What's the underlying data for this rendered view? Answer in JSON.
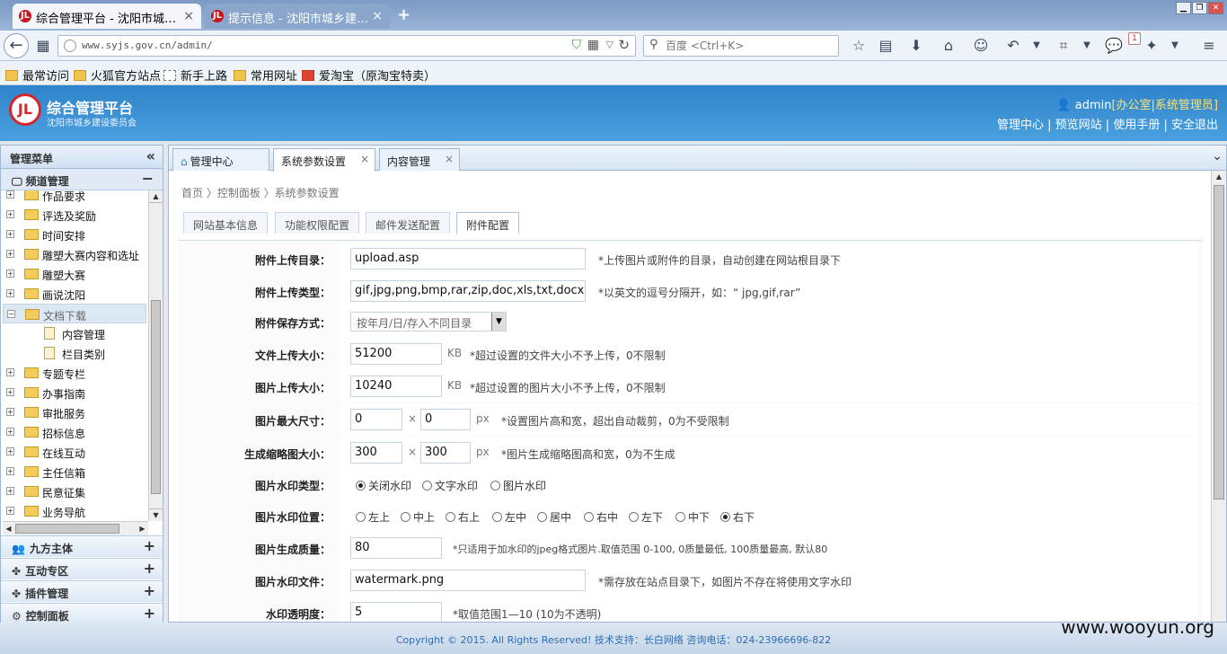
{
  "browser": {
    "tabs": [
      {
        "title": "综合管理平台 - 沈阳市城…",
        "active": true
      },
      {
        "title": "提示信息 - 沈阳市城乡建…",
        "active": false
      }
    ],
    "url": "www.syjs.gov.cn/admin/",
    "search_placeholder": "百度 <Ctrl+K>",
    "badge": "1",
    "bookmarks": [
      "最常访问",
      "火狐官方站点",
      "新手上路",
      "常用网址",
      "爱淘宝（原淘宝特卖）"
    ]
  },
  "header": {
    "logo_text": "JL",
    "title": "综合管理平台",
    "subtitle": "沈阳市城乡建设委员会",
    "user": "admin",
    "role": "[办公室|系统管理员]",
    "links": [
      "管理中心",
      "预览网站",
      "使用手册",
      "安全退出"
    ],
    "separator": " | "
  },
  "sidebar": {
    "title": "管理菜单",
    "collapse_glyph": "«",
    "channel_title": "频道管理",
    "channel_toggle": "−",
    "tree": [
      {
        "label": "作品要求",
        "toggle": "+"
      },
      {
        "label": "评选及奖励",
        "toggle": "+"
      },
      {
        "label": "时间安排",
        "toggle": "+"
      },
      {
        "label": "雕塑大赛内容和选址",
        "toggle": "+"
      },
      {
        "label": "雕塑大赛",
        "toggle": "+"
      },
      {
        "label": "画说沈阳",
        "toggle": "+"
      },
      {
        "label": "文档下载",
        "toggle": "−",
        "selected": true
      },
      {
        "label": "内容管理",
        "child": true
      },
      {
        "label": "栏目类别",
        "child": true
      },
      {
        "label": "专题专栏",
        "toggle": "+"
      },
      {
        "label": "办事指南",
        "toggle": "+"
      },
      {
        "label": "审批服务",
        "toggle": "+"
      },
      {
        "label": "招标信息",
        "toggle": "+"
      },
      {
        "label": "在线互动",
        "toggle": "+"
      },
      {
        "label": "主任信箱",
        "toggle": "+"
      },
      {
        "label": "民意征集",
        "toggle": "+"
      },
      {
        "label": "业务导航",
        "toggle": "+"
      }
    ],
    "sections": [
      {
        "icon": "👥",
        "label": "九方主体",
        "toggle": "+"
      },
      {
        "icon": "✤",
        "label": "互动专区",
        "toggle": "+"
      },
      {
        "icon": "✤",
        "label": "插件管理",
        "toggle": "+"
      },
      {
        "icon": "⚙",
        "label": "控制面板",
        "toggle": "+"
      }
    ]
  },
  "main": {
    "tabs": [
      {
        "label": "管理中心",
        "icon": "⌂",
        "closable": false
      },
      {
        "label": "系统参数设置",
        "closable": true,
        "active": true
      },
      {
        "label": "内容管理",
        "closable": true
      }
    ],
    "close_glyph": "×",
    "breadcrumb": "首页 〉控制面板 〉系统参数设置",
    "subtabs": [
      "网站基本信息",
      "功能权限配置",
      "邮件发送配置",
      "附件配置"
    ],
    "active_subtab": 3,
    "form": {
      "upload_dir": {
        "label": "附件上传目录：",
        "value": "upload.asp",
        "hint": "*上传图片或附件的目录，自动创建在网站根目录下"
      },
      "upload_types": {
        "label": "附件上传类型：",
        "value": "gif,jpg,png,bmp,rar,zip,doc,xls,txt,docx,pptx,xlsx",
        "hint": "*以英文的逗号分隔开，如：“ jpg,gif,rar”"
      },
      "save_mode": {
        "label": "附件保存方式：",
        "value": "按年月/日/存入不同目录"
      },
      "file_size": {
        "label": "文件上传大小：",
        "value": "51200",
        "unit": "KB",
        "hint": "*超过设置的文件大小不予上传，0不限制"
      },
      "image_size": {
        "label": "图片上传大小：",
        "value": "10240",
        "unit": "KB",
        "hint": "*超过设置的图片大小不予上传，0不限制"
      },
      "image_max_dim": {
        "label": "图片最大尺寸：",
        "width": "0",
        "height": "0",
        "times": "×",
        "unit": "px",
        "hint": "*设置图片高和宽，超出自动裁剪，0为不受限制"
      },
      "thumb_size": {
        "label": "生成缩略图大小：",
        "width": "300",
        "height": "300",
        "times": "×",
        "unit": "px",
        "hint": "*图片生成缩略图高和宽，0为不生成"
      },
      "watermark_type": {
        "label": "图片水印类型：",
        "options": [
          "关闭水印",
          "文字水印",
          "图片水印"
        ],
        "selected": 0
      },
      "watermark_pos": {
        "label": "图片水印位置：",
        "options": [
          "左上",
          "中上",
          "右上",
          "左中",
          "居中",
          "右中",
          "左下",
          "中下",
          "右下"
        ],
        "selected": 8
      },
      "quality": {
        "label": "图片生成质量：",
        "value": "80",
        "hint": "*只适用于加水印的jpeg格式图片.取值范围 0-100, 0质量最低, 100质量最高, 默认80"
      },
      "watermark_file": {
        "label": "图片水印文件：",
        "value": "watermark.png",
        "hint": "*需存放在站点目录下，如图片不存在将使用文字水印"
      },
      "opacity": {
        "label": "水印透明度：",
        "value": "5",
        "hint": "*取值范围1—10 (10为不透明)"
      }
    }
  },
  "footer": "Copyright © 2015. All Rights Reserved! 技术支持：长白网络 咨询电话：024-23966696-822",
  "watermark": "www.wooyun.org"
}
